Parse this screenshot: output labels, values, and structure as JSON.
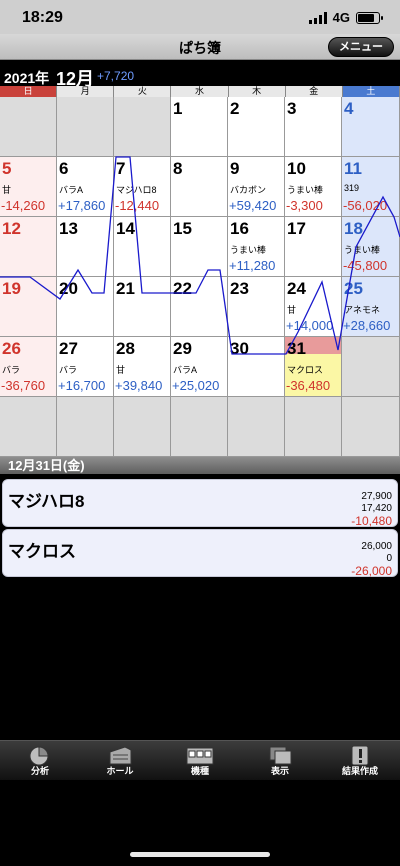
{
  "status": {
    "time": "18:29",
    "network": "4G"
  },
  "nav": {
    "title": "ぱち簿",
    "menu_label": "メニュー"
  },
  "month": {
    "year_label": "2021年",
    "month_label": "12月",
    "total": "+7,720"
  },
  "weekdays": [
    "日",
    "月",
    "火",
    "水",
    "木",
    "金",
    "土"
  ],
  "calendar_days": [
    {
      "day": "1",
      "machine": "",
      "amount": ""
    },
    {
      "day": "2",
      "machine": "",
      "amount": ""
    },
    {
      "day": "3",
      "machine": "",
      "amount": ""
    },
    {
      "day": "4",
      "machine": "",
      "amount": ""
    },
    {
      "day": "5",
      "machine": "甘",
      "amount": "-14,260"
    },
    {
      "day": "6",
      "machine": "バラA",
      "amount": "+17,860"
    },
    {
      "day": "7",
      "machine": "マジハロ8",
      "amount": "-12,440"
    },
    {
      "day": "8",
      "machine": "",
      "amount": ""
    },
    {
      "day": "9",
      "machine": "バカボン",
      "amount": "+59,420"
    },
    {
      "day": "10",
      "machine": "うまい棒",
      "amount": "-3,300"
    },
    {
      "day": "11",
      "machine": "319",
      "amount": "-56,020"
    },
    {
      "day": "12",
      "machine": "",
      "amount": ""
    },
    {
      "day": "13",
      "machine": "",
      "amount": ""
    },
    {
      "day": "14",
      "machine": "",
      "amount": ""
    },
    {
      "day": "15",
      "machine": "",
      "amount": ""
    },
    {
      "day": "16",
      "machine": "うまい棒",
      "amount": "+11,280"
    },
    {
      "day": "17",
      "machine": "",
      "amount": ""
    },
    {
      "day": "18",
      "machine": "うまい棒",
      "amount": "-45,800"
    },
    {
      "day": "19",
      "machine": "",
      "amount": ""
    },
    {
      "day": "20",
      "machine": "",
      "amount": ""
    },
    {
      "day": "21",
      "machine": "",
      "amount": ""
    },
    {
      "day": "22",
      "machine": "",
      "amount": ""
    },
    {
      "day": "23",
      "machine": "",
      "amount": ""
    },
    {
      "day": "24",
      "machine": "甘",
      "amount": "+14,000"
    },
    {
      "day": "25",
      "machine": "アネモネ",
      "amount": "+28,660"
    },
    {
      "day": "26",
      "machine": "バラ",
      "amount": "-36,760"
    },
    {
      "day": "27",
      "machine": "バラ",
      "amount": "+16,700"
    },
    {
      "day": "28",
      "machine": "甘",
      "amount": "+39,840"
    },
    {
      "day": "29",
      "machine": "バラA",
      "amount": "+25,020"
    },
    {
      "day": "30",
      "machine": "",
      "amount": ""
    },
    {
      "day": "31",
      "machine": "マクロス",
      "amount": "-36,480"
    }
  ],
  "detail": {
    "date_label": "12月31日(金)",
    "entries": [
      {
        "name": "マジハロ8",
        "invest": "27,900",
        "recover": "17,420",
        "balance": "-10,480"
      },
      {
        "name": "マクロス",
        "invest": "26,000",
        "recover": "0",
        "balance": "-26,000"
      }
    ]
  },
  "tabs": [
    {
      "label": "分析",
      "icon": "pie-chart-icon"
    },
    {
      "label": "ホール",
      "icon": "building-icon"
    },
    {
      "label": "機種",
      "icon": "slot-machine-icon"
    },
    {
      "label": "表示",
      "icon": "display-icon"
    },
    {
      "label": "結果作成",
      "icon": "pen-icon"
    }
  ],
  "colors": {
    "sunday": "#d0342c",
    "saturday": "#2d5fc4",
    "positive": "#2d5fc4",
    "negative": "#d0342c",
    "graph_line": "#1a1acc",
    "today_band": "#e89b9b",
    "today_fill": "#fbf7a5"
  },
  "chart_data": {
    "type": "line",
    "note_series": "cumulative balance overlay drawn across calendar",
    "x": [
      "1",
      "2",
      "3",
      "4",
      "5",
      "6",
      "7",
      "8",
      "9",
      "10",
      "11",
      "12",
      "13",
      "14",
      "15",
      "16",
      "17",
      "18",
      "19",
      "20",
      "21",
      "22",
      "23",
      "24",
      "25",
      "26",
      "27",
      "28",
      "29",
      "30",
      "31"
    ]
  }
}
